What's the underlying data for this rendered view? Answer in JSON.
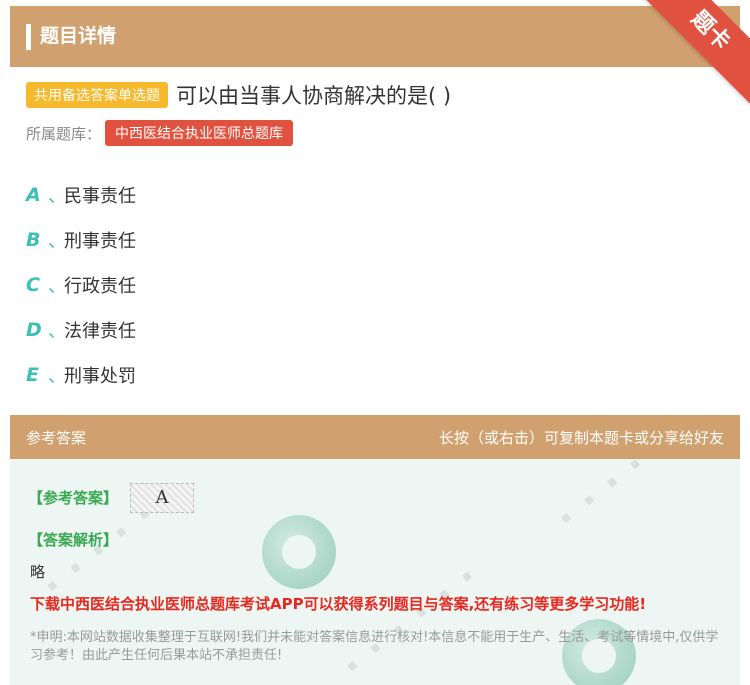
{
  "header": {
    "title": "题目详情",
    "ribbon": "题卡"
  },
  "question": {
    "type_tag": "共用备选答案单选题",
    "text": "可以由当事人协商解决的是( )",
    "bank_label": "所属题库：",
    "bank_name": "中西医结合执业医师总题库"
  },
  "options": [
    {
      "letter": "A",
      "sep": "、",
      "text": "民事责任"
    },
    {
      "letter": "B",
      "sep": "、",
      "text": "刑事责任"
    },
    {
      "letter": "C",
      "sep": "、",
      "text": "行政责任"
    },
    {
      "letter": "D",
      "sep": "、",
      "text": "法律责任"
    },
    {
      "letter": "E",
      "sep": "、",
      "text": "刑事处罚"
    }
  ],
  "answer_section": {
    "title": "参考答案",
    "hint": "长按（或右击）可复制本题卡或分享给好友",
    "answer_label": "【参考答案】",
    "answer_value": "A",
    "analysis_label": "【答案解析】",
    "analysis_text": "略",
    "promo": "下载中西医结合执业医师总题库考试APP可以获得系列题目与答案,还有练习等更多学习功能!",
    "disclaimer": "*申明:本网站数据收集整理于互联网!我们并未能对答案信息进行核对!本信息不能用于生产、生活、考试等情境中,仅供学习参考！由此产生任何后果本站不承担责任!"
  },
  "colors": {
    "brand": "#d0a06e",
    "accent_red": "#e0513f",
    "option_teal": "#3bbfb6",
    "tag_yellow": "#f7b92c",
    "green": "#3aa853"
  }
}
